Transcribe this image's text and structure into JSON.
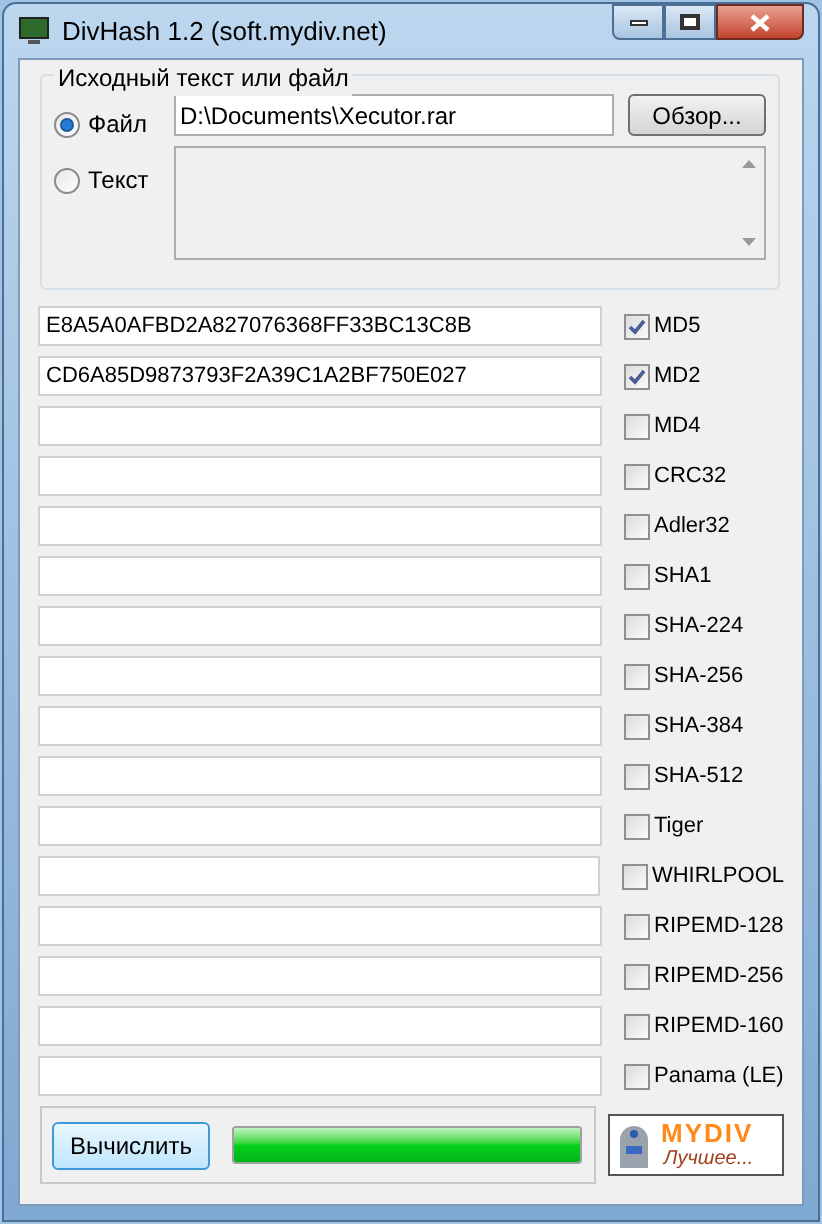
{
  "window": {
    "title": "DivHash 1.2 (soft.mydiv.net)"
  },
  "source": {
    "legend": "Исходный текст или файл",
    "options": [
      {
        "label": "Файл",
        "selected": true
      },
      {
        "label": "Текст",
        "selected": false
      }
    ],
    "file_value": "D:\\Documents\\Xecutor.rar",
    "browse_button": "Обзор..."
  },
  "hashes": [
    {
      "name": "MD5",
      "checked": true,
      "value": "E8A5A0AFBD2A827076368FF33BC13C8B"
    },
    {
      "name": "MD2",
      "checked": true,
      "value": "CD6A85D9873793F2A39C1A2BF750E027"
    },
    {
      "name": "MD4",
      "checked": false
    },
    {
      "name": "CRC32",
      "checked": false
    },
    {
      "name": "Adler32",
      "checked": false
    },
    {
      "name": "SHA1",
      "checked": false
    },
    {
      "name": "SHA-224",
      "checked": false
    },
    {
      "name": "SHA-256",
      "checked": false
    },
    {
      "name": "SHA-384",
      "checked": false
    },
    {
      "name": "SHA-512",
      "checked": false
    },
    {
      "name": "Tiger",
      "checked": false
    },
    {
      "name": "WHIRLPOOL",
      "checked": false
    },
    {
      "name": "RIPEMD-128",
      "checked": false
    },
    {
      "name": "RIPEMD-256",
      "checked": false
    },
    {
      "name": "RIPEMD-160",
      "checked": false
    },
    {
      "name": "Panama (LE)",
      "checked": false
    }
  ],
  "compute_button": "Вычислить",
  "progress": {
    "level": 1
  },
  "logo": {
    "brand": "MYDIV",
    "slogan": "Лучшее..."
  }
}
